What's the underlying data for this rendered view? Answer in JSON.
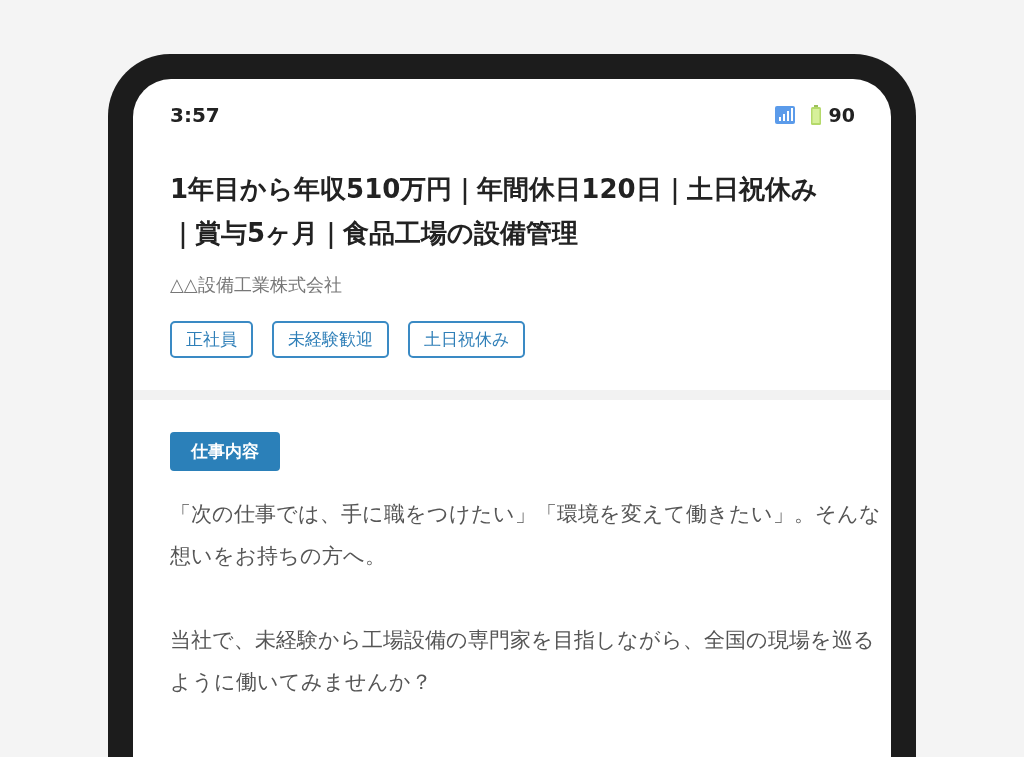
{
  "status_bar": {
    "time": "3:57",
    "battery": "90"
  },
  "job": {
    "title": "1年目から年収510万円｜年間休日120日｜土日祝休み｜賞与5ヶ月｜食品工場の設備管理",
    "company": "△△設備工業株式会社",
    "tags": [
      "正社員",
      "未経験歓迎",
      "土日祝休み"
    ]
  },
  "section": {
    "heading": "仕事内容",
    "paragraphs": [
      "「次の仕事では、手に職をつけたい」「環境を変えて働きたい」。そんな想いをお持ちの方へ。",
      "当社で、未経験から工場設備の専門家を目指しながら、全国の現場を巡るように働いてみませんか？"
    ]
  }
}
